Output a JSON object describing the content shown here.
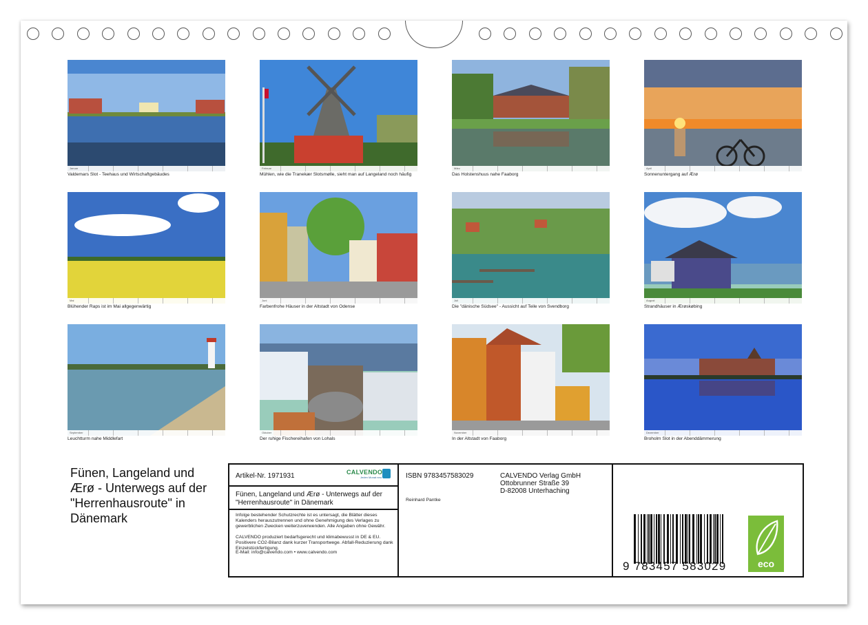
{
  "photos": [
    {
      "caption": "Valdemars Slot  - Teehaus und Wirtschaftgebäudes",
      "month": "Januar"
    },
    {
      "caption": "Mühlen, wie die Tranekær Slotsmølle, sieht man auf Langeland noch häufig",
      "month": "Februar"
    },
    {
      "caption": "Das Holstenshuus nahe Faaborg",
      "month": "März"
    },
    {
      "caption": "Sonnenuntergang auf Ærø",
      "month": "April"
    },
    {
      "caption": "Blühender Raps ist im Mai allgegenwärtig",
      "month": "Mai"
    },
    {
      "caption": "Farbenfrohe Häuser in der Altstadt von Odense",
      "month": "Juni"
    },
    {
      "caption": "Die \"dänische Südsee\" - Aussicht auf Teile von Svendborg",
      "month": "Juli"
    },
    {
      "caption": "Strandhäuser in Ærøskøbing",
      "month": "August"
    },
    {
      "caption": "Leuchtturm nahe Middlefart",
      "month": "September"
    },
    {
      "caption": "Der ruhige Fischereihafen von Lohals",
      "month": "Oktober"
    },
    {
      "caption": "In der Altstadt von Faaborg",
      "month": "November"
    },
    {
      "caption": "Broholm Slot in der Abenddämmerung",
      "month": "Dezember"
    }
  ],
  "title": "Fünen, Langeland und Ærø - Unterwegs auf der \"Herrenhausroute\" in  Dänemark",
  "info": {
    "article": "Artikel-Nr. 1971931",
    "logo": "CALVENDO",
    "logo_sub": "Jeden Monat neu",
    "subtitle": "Fünen, Langeland und Ærø - Unterwegs auf der \"Herrenhausroute\" in  Dänemark",
    "legal": "Infolge bestehender Schutzrechte ist es untersagt, die Blätter dieses Kalenders herauszutrennen und ohne Genehmigung des Verlages zu gewerblichen Zwecken weiterzuverwenden. Alle Angaben ohne Gewähr.",
    "legal2": "CALVENDO produziert bedarfsgerecht und klimabewusst in DE & EU. Positivere CO2-Bilanz dank kurzer Transportwege. Abfall-Reduzierung dank Einzelstückfertigung.",
    "email": "E-Mail: info@calvendo.com • www.calvendo.com",
    "isbn": "ISBN 9783457583029",
    "author": "Reinhard Pantke",
    "publisher": "CALVENDO Verlag GmbH",
    "street": "Ottobrunner Straße 39",
    "city": "D-82008 Unterhaching",
    "barcode_number": "9 783457 583029",
    "eco": "eco"
  }
}
